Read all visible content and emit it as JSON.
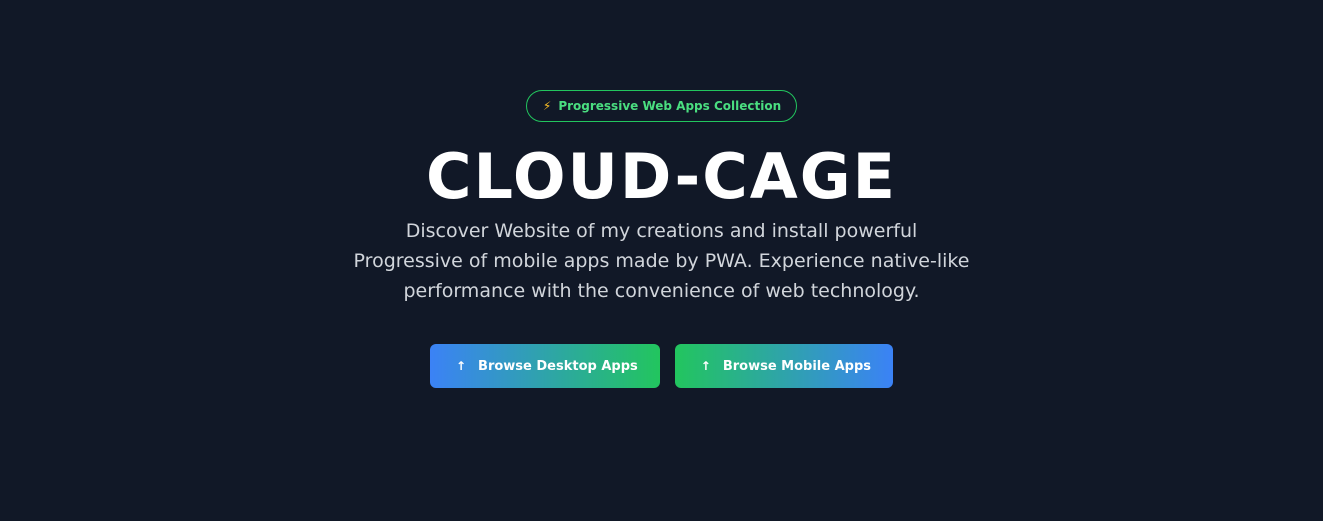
{
  "badge": {
    "icon": "lightning-icon",
    "icon_glyph": "⚡",
    "label": "Progressive Web Apps Collection"
  },
  "hero": {
    "title": "CLOUD-CAGE",
    "subtitle": "Discover Website of my creations and install powerful Progressive of mobile apps made by PWA. Experience native-like performance with the convenience of web technology."
  },
  "buttons": {
    "desktop": {
      "icon": "arrow-up-icon",
      "icon_glyph": "↑",
      "label": "Browse Desktop Apps"
    },
    "mobile": {
      "icon": "arrow-up-icon",
      "icon_glyph": "↑",
      "label": "Browse Mobile Apps"
    }
  },
  "colors": {
    "background": "#111827",
    "accent_green": "#22c55e",
    "accent_blue": "#3b82f6",
    "badge_text": "#4ade80",
    "icon_yellow": "#fbbf24"
  }
}
